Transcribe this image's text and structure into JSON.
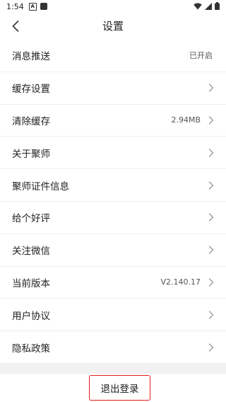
{
  "status_bar": {
    "time": "1:54",
    "notif_glyph": "A"
  },
  "header": {
    "title": "设置"
  },
  "settings": [
    {
      "label": "消息推送",
      "value": "已开启",
      "chevron": false
    },
    {
      "label": "缓存设置",
      "value": "",
      "chevron": true
    },
    {
      "label": "清除缓存",
      "value": "2.94MB",
      "chevron": true
    },
    {
      "label": "关于聚师",
      "value": "",
      "chevron": true
    },
    {
      "label": "聚师证件信息",
      "value": "",
      "chevron": true
    },
    {
      "label": "给个好评",
      "value": "",
      "chevron": true
    },
    {
      "label": "关注微信",
      "value": "",
      "chevron": true
    },
    {
      "label": "当前版本",
      "value": "V2.140.17",
      "chevron": true
    },
    {
      "label": "用户协议",
      "value": "",
      "chevron": true
    },
    {
      "label": "隐私政策",
      "value": "",
      "chevron": true
    }
  ],
  "logout": {
    "label": "退出登录",
    "border_color": "#e0201c"
  },
  "icons": {
    "back": "back-arrow-icon",
    "chevron": "chevron-right-icon",
    "wifi": "wifi-icon",
    "signal": "signal-icon",
    "battery": "battery-icon"
  }
}
